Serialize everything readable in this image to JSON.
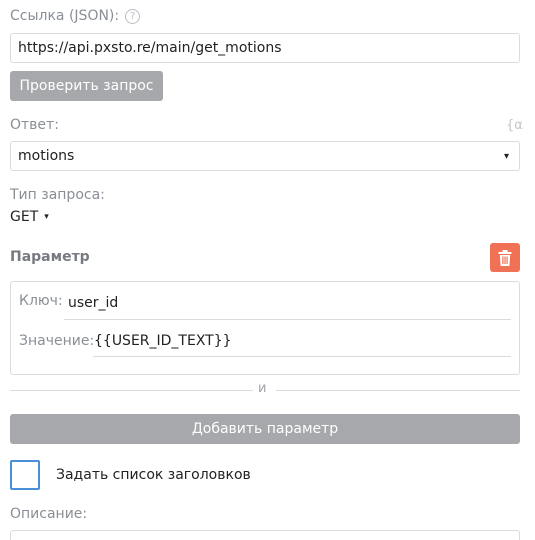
{
  "url": {
    "label": "Ссылка (JSON):",
    "help_glyph": "?",
    "value": "https://api.pxsto.re/main/get_motions"
  },
  "check_button": {
    "label": "Проверить запрос"
  },
  "response": {
    "label": "Ответ:",
    "side_glyph": "{α",
    "value": "motions",
    "dropdown_glyph": "▾"
  },
  "request_type": {
    "label": "Тип запроса:",
    "value": "GET",
    "dropdown_glyph": "▾"
  },
  "parameter": {
    "title": "Параметр",
    "key_label": "Ключ:",
    "key_value": "user_id",
    "value_label": "Значение:",
    "value_value": "{{USER_ID_TEXT}}"
  },
  "divider": {
    "text": "и"
  },
  "add_parameter_button": {
    "label": "Добавить параметр"
  },
  "headers_checkbox": {
    "label": "Задать список заголовков",
    "checked": false
  },
  "description": {
    "label": "Описание:"
  },
  "colors": {
    "button_gray": "#a6a8ab",
    "delete_red": "#f07156",
    "checkbox_blue": "#4a90d9",
    "label_gray": "#8a8f96",
    "border": "#d9dcdf"
  }
}
